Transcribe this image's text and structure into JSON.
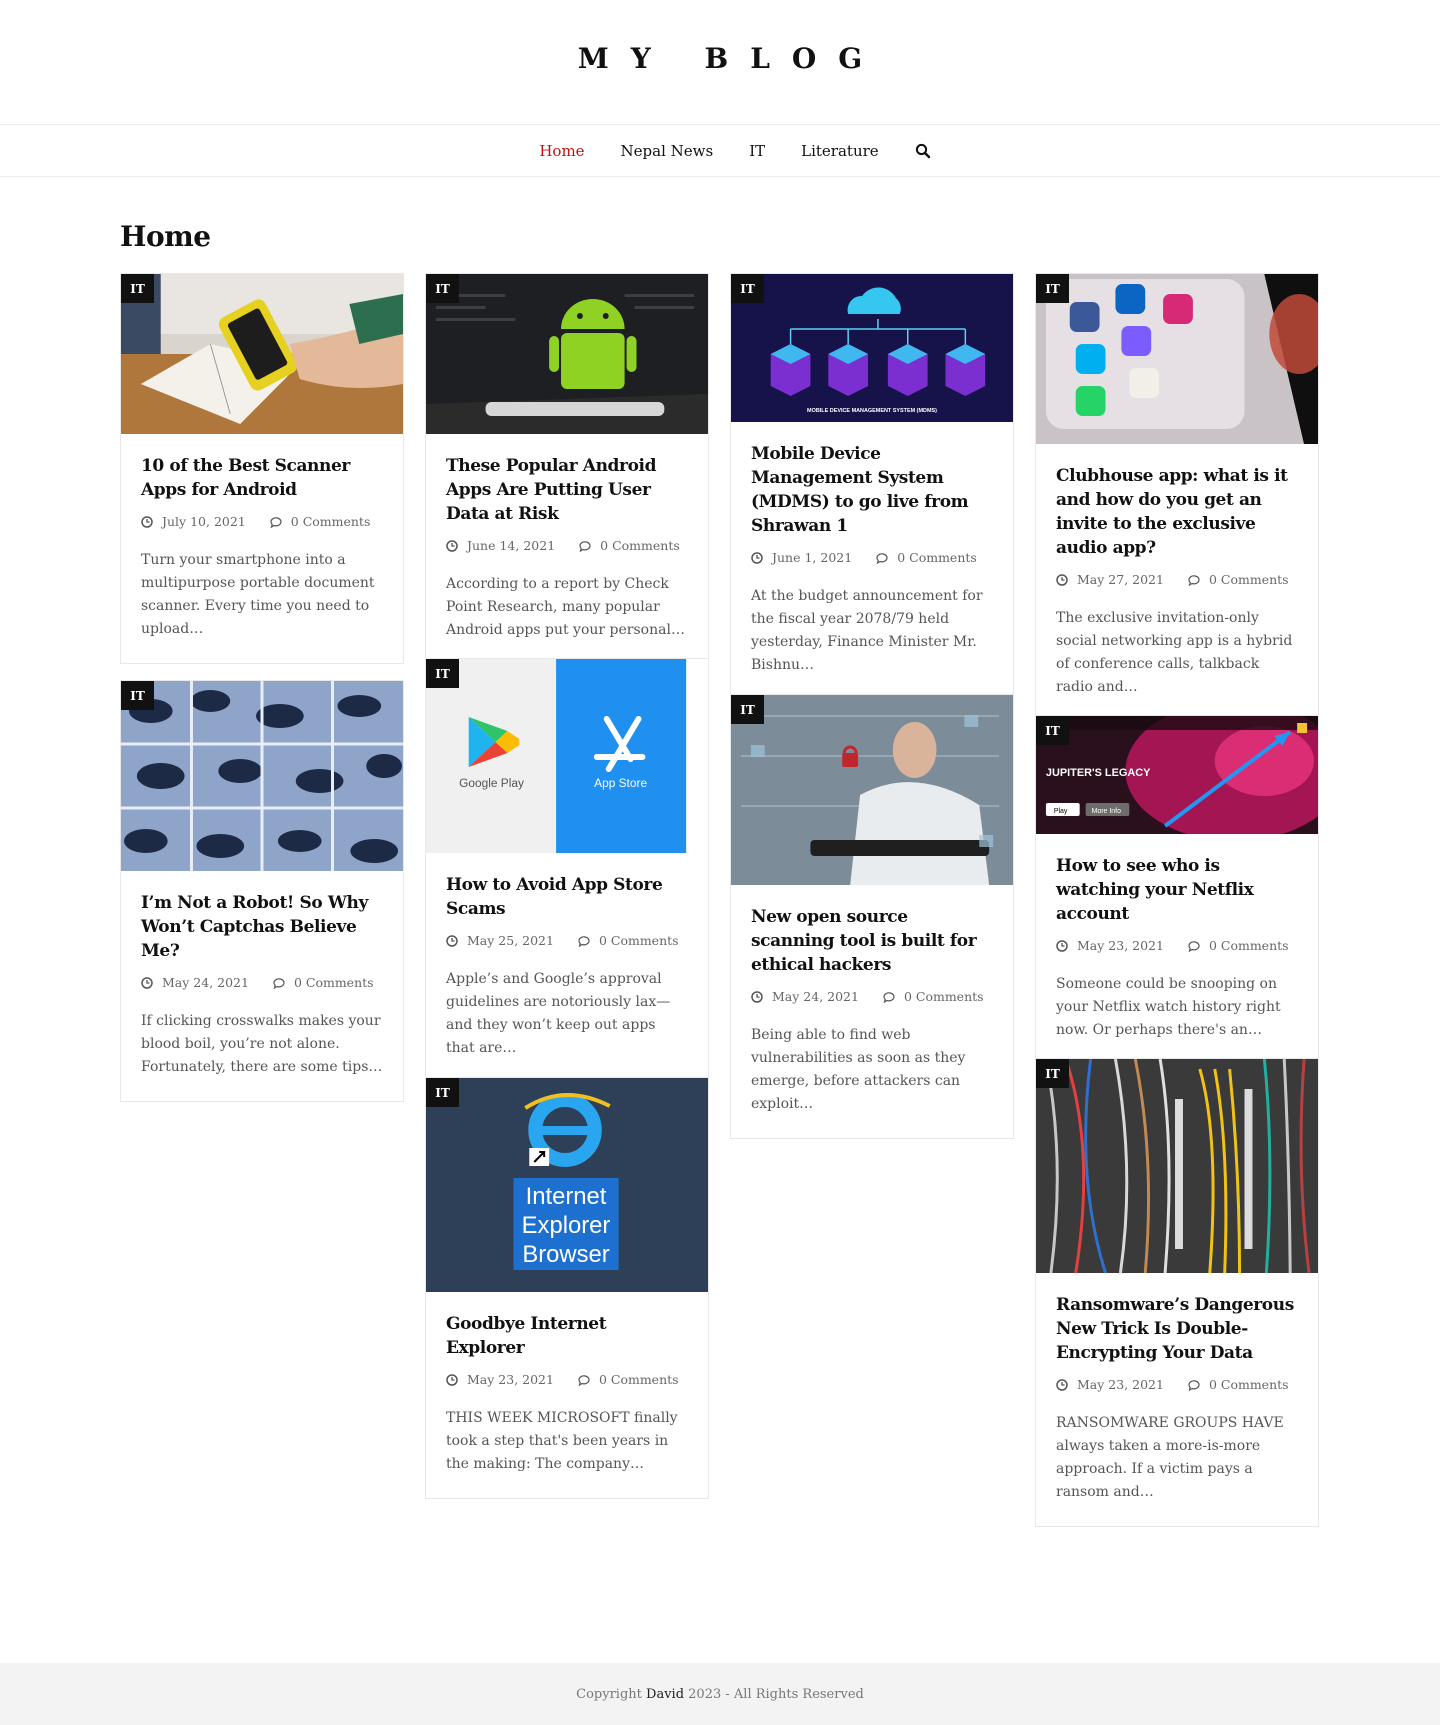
{
  "site": {
    "title": "MY BLOG"
  },
  "nav": {
    "items": [
      {
        "label": "Home"
      },
      {
        "label": "Nepal News"
      },
      {
        "label": "IT"
      },
      {
        "label": "Literature"
      }
    ]
  },
  "page": {
    "heading": "Home"
  },
  "posts": [
    {
      "category": "IT",
      "title": "10 of the Best Scanner Apps for Android",
      "date": "July 10, 2021",
      "comments": "0 Comments",
      "excerpt": "Turn your smartphone into a multipurpose portable document scanner. Every time you need to upload…"
    },
    {
      "category": "IT",
      "title": "I’m Not a Robot! So Why Won’t Captchas Believe Me?",
      "date": "May 24, 2021",
      "comments": "0 Comments",
      "excerpt": "If clicking crosswalks makes your blood boil, you’re not alone. Fortunately, there are some tips…"
    },
    {
      "category": "IT",
      "title": "These Popular Android Apps Are Putting User Data at Risk",
      "date": "June 14, 2021",
      "comments": "0 Comments",
      "excerpt": "According to a report by Check Point Research, many popular Android apps put your personal…"
    },
    {
      "category": "IT",
      "title": "How to Avoid App Store Scams",
      "date": "May 25, 2021",
      "comments": "0 Comments",
      "excerpt": "Apple’s and Google’s approval guidelines are notoriously lax—and they won’t keep out apps that are…",
      "image_text": {
        "google": "Google Play",
        "apple": "App Store"
      }
    },
    {
      "category": "IT",
      "title": "Goodbye Internet Explorer",
      "date": "May 23, 2021",
      "comments": "0 Comments",
      "excerpt": "THIS WEEK MICROSOFT finally took a step that's been years in the making: The company…",
      "image_text": {
        "line1": "Internet",
        "line2": "Explorer",
        "line3": "Browser"
      }
    },
    {
      "category": "IT",
      "title": "Mobile Device Management System (MDMS) to go live from Shrawan 1",
      "date": "June 1, 2021",
      "comments": "0 Comments",
      "excerpt": "At the budget announcement for the fiscal year 2078/79 held yesterday, Finance Minister Mr. Bishnu…",
      "image_text": {
        "caption": "MOBILE DEVICE MANAGEMENT SYSTEM (MDMS)"
      }
    },
    {
      "category": "IT",
      "title": "New open source scanning tool is built for ethical hackers",
      "date": "May 24, 2021",
      "comments": "0 Comments",
      "excerpt": "Being able to find web vulnerabilities as soon as they emerge, before attackers can exploit…"
    },
    {
      "category": "IT",
      "title": "Clubhouse app: what is it and how do you get an invite to the exclusive audio app?",
      "date": "May 27, 2021",
      "comments": "0 Comments",
      "excerpt": "The exclusive invitation-only social networking app is a hybrid of conference calls, talkback radio and…"
    },
    {
      "category": "IT",
      "title": "How to see who is watching your Netflix account",
      "date": "May 23, 2021",
      "comments": "0 Comments",
      "excerpt": "Someone could be snooping on your Netflix watch history right now. Or perhaps there's an…",
      "image_text": {
        "show": "JUPITER'S LEGACY",
        "play": "Play",
        "more": "More Info"
      }
    },
    {
      "category": "IT",
      "title": "Ransomware’s Dangerous New Trick Is Double-Encrypting Your Data",
      "date": "May 23, 2021",
      "comments": "0 Comments",
      "excerpt": "RANSOMWARE GROUPS HAVE always taken a more-is-more approach. If a victim pays a ransom and…"
    }
  ],
  "footer": {
    "prefix": "Copyright ",
    "author": "David",
    "suffix": " 2023 - All Rights Reserved"
  },
  "colors": {
    "accent": "#c21212",
    "badge": "#111111",
    "footer_bg": "#f3f3f3"
  }
}
